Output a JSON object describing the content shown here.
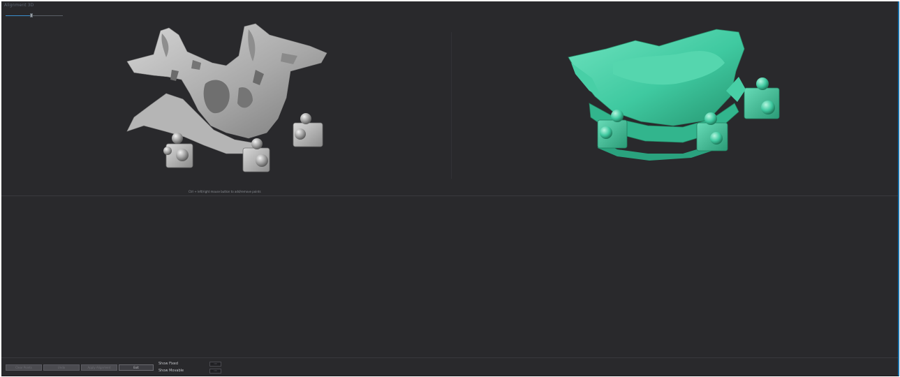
{
  "window": {
    "title": "Alignment 3D"
  },
  "opacity_slider": {
    "value_fraction": 0.45
  },
  "viewports": {
    "fixed": {
      "model": "bone-scan-with-markers",
      "color": "#b9b9b9"
    },
    "movable": {
      "model": "denture-scan-with-markers",
      "color": "#3fc9a0"
    }
  },
  "hint_text": "Ctrl + left/right mouse button to add/remove points",
  "toolbar": {
    "buttons": [
      {
        "label": "Clear Points",
        "enabled": false
      },
      {
        "label": "Undo",
        "enabled": false
      },
      {
        "label": "Apply Alignment",
        "enabled": false
      },
      {
        "label": "Exit",
        "enabled": true
      }
    ]
  },
  "options": {
    "show_fixed_label": "Show Fixed",
    "show_fixed_value": "ON",
    "show_movable_label": "Show Movable",
    "show_movable_value": "ON"
  },
  "colors": {
    "background": "#29292c",
    "accent": "#1a6fa8",
    "movable_model": "#3fc9a0",
    "fixed_model": "#b9b9b9"
  }
}
